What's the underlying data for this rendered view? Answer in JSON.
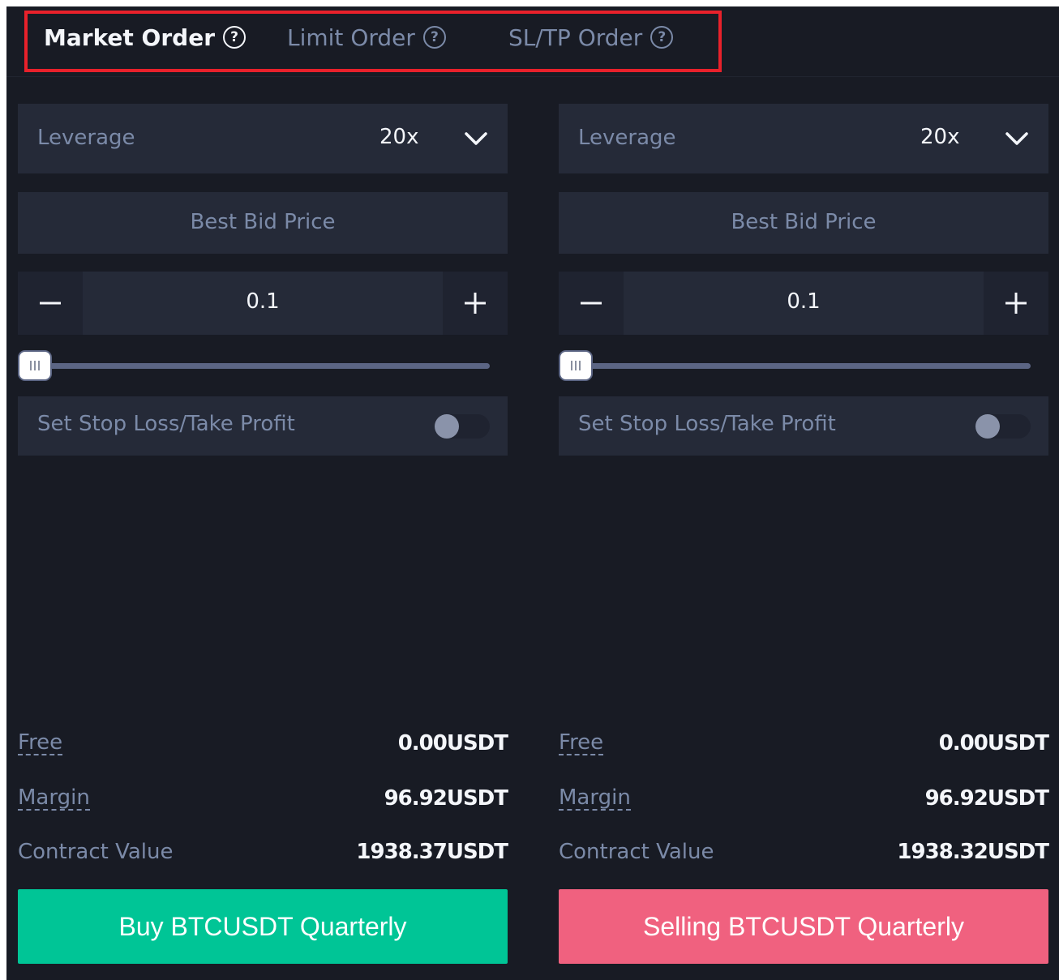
{
  "tabs": [
    {
      "label": "Market Order",
      "active": true
    },
    {
      "label": "Limit Order",
      "active": false
    },
    {
      "label": "SL/TP Order",
      "active": false
    }
  ],
  "help_icon": "question-circle-icon",
  "buy": {
    "leverage_label": "Leverage",
    "leverage_value": "20x",
    "price_label": "Best Bid Price",
    "quantity": "0.1",
    "slider_level": 0,
    "sltp_label": "Set Stop Loss/Take Profit",
    "sltp_enabled": false,
    "free_label": "Free",
    "free_value": "0.00USDT",
    "margin_label": "Margin",
    "margin_value": "96.92USDT",
    "contract_label": "Contract Value",
    "contract_value": "1938.37USDT",
    "button_label": "Buy BTCUSDT Quarterly",
    "button_color": "#00c596"
  },
  "sell": {
    "leverage_label": "Leverage",
    "leverage_value": "20x",
    "price_label": "Best Bid Price",
    "quantity": "0.1",
    "slider_level": 0,
    "sltp_label": "Set Stop Loss/Take Profit",
    "sltp_enabled": false,
    "free_label": "Free",
    "free_value": "0.00USDT",
    "margin_label": "Margin",
    "margin_value": "96.92USDT",
    "contract_label": "Contract Value",
    "contract_value": "1938.32USDT",
    "button_label": "Selling BTCUSDT Quarterly",
    "button_color": "#f0617f"
  },
  "colors": {
    "background": "#181b24",
    "panel": "#252a38",
    "muted_text": "#7b8aa8",
    "highlight_border": "#e8212b"
  }
}
